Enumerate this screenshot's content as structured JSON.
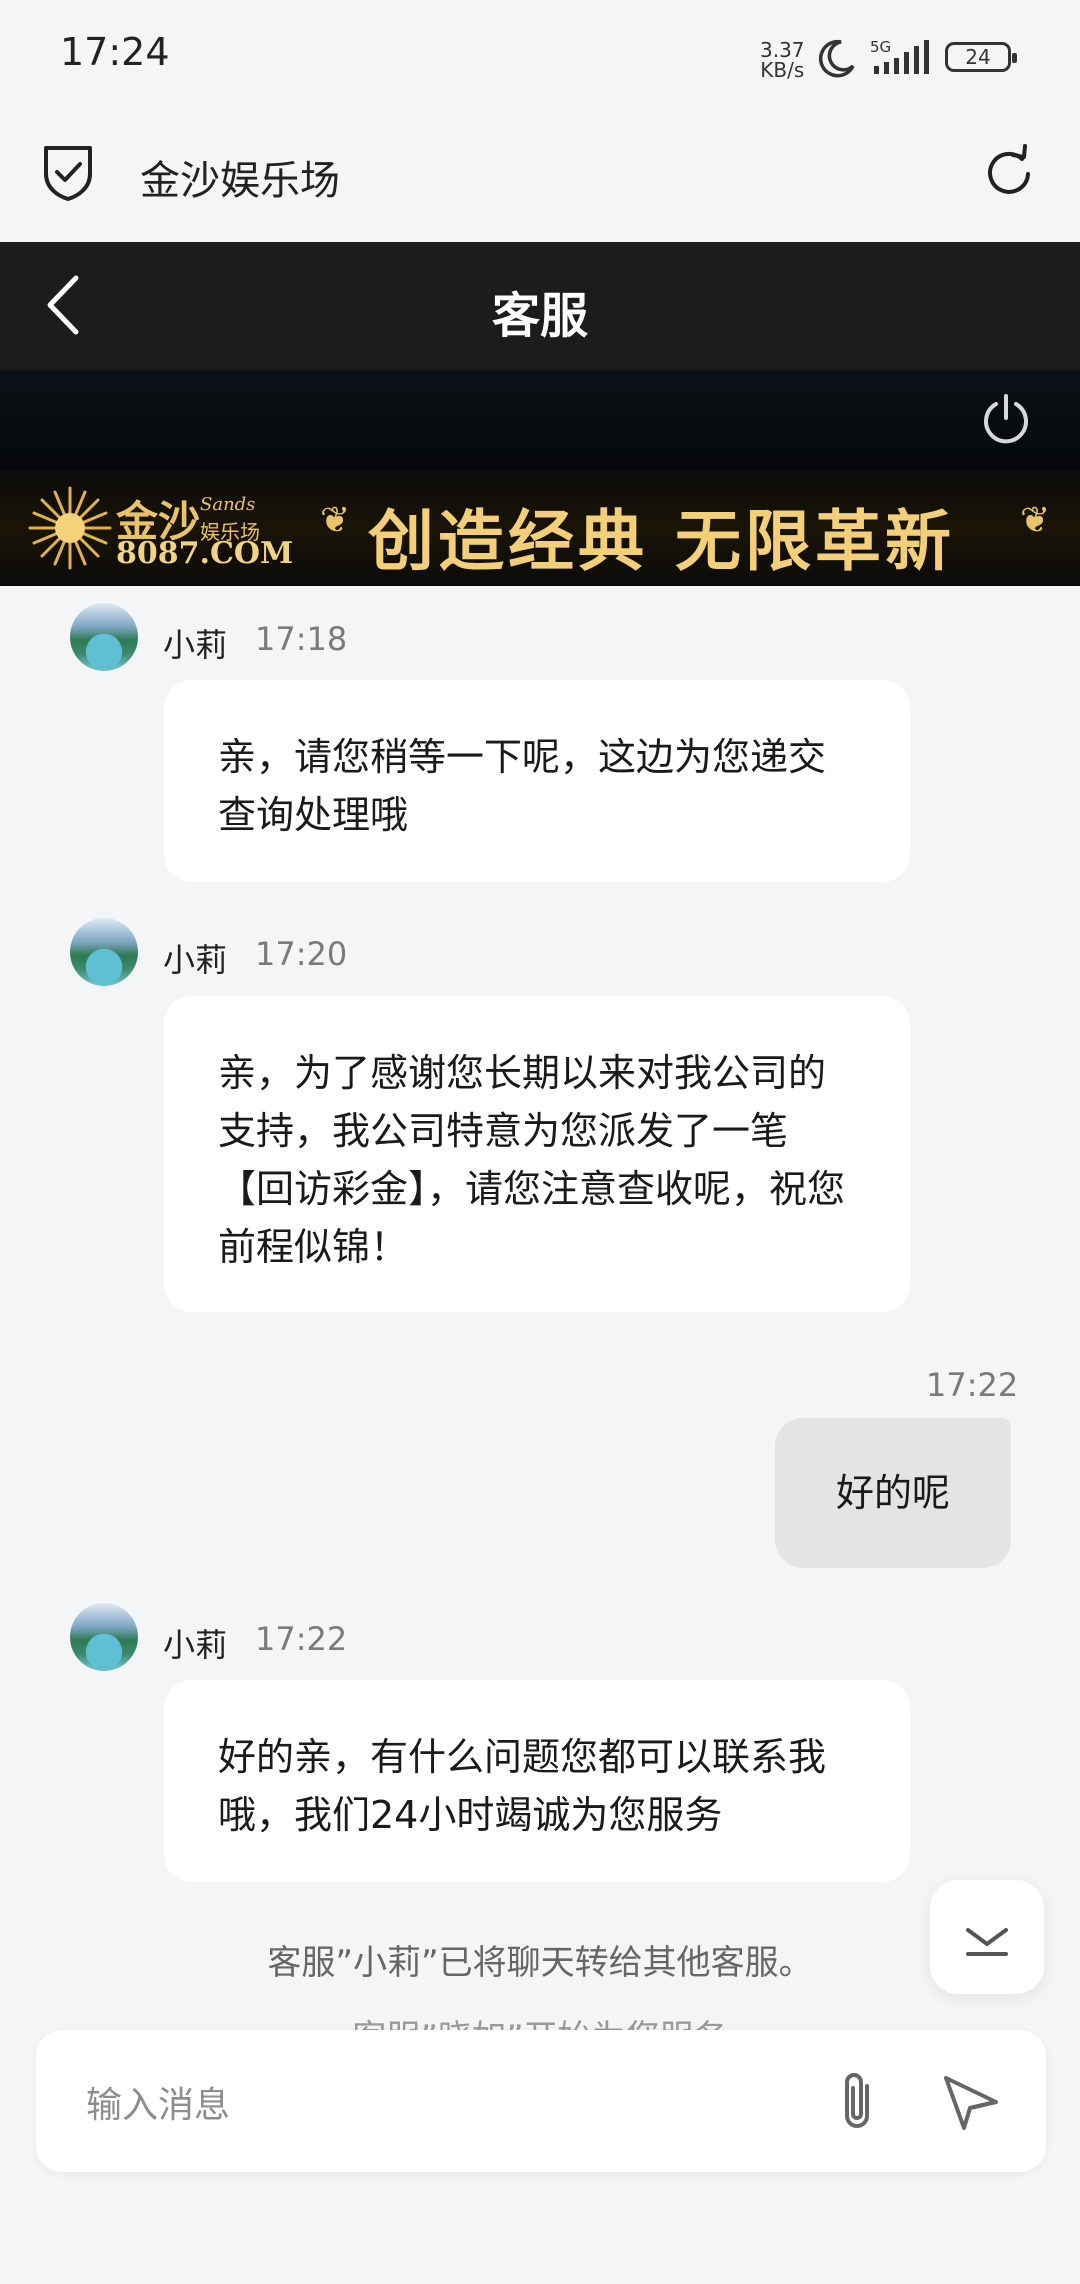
{
  "status_bar": {
    "time": "17:24",
    "net_speed_value": "3.37",
    "net_speed_unit": "KB/s",
    "network": "5G",
    "battery": "24"
  },
  "browser_bar": {
    "title": "金沙娱乐场"
  },
  "chat_header": {
    "title": "客服"
  },
  "banner": {
    "brand_name": "金沙",
    "brand_sands": "Sands",
    "brand_sub": "娱乐场",
    "brand_url": "8087.COM",
    "slogan": "创造经典 无限革新"
  },
  "messages": [
    {
      "sender": "小莉",
      "time": "17:18",
      "text": "亲，请您稍等一下呢，这边为您递交查询处理哦"
    },
    {
      "sender": "小莉",
      "time": "17:20",
      "text": "亲，为了感谢您长期以来对我公司的支持，我公司特意为您派发了一笔【回访彩金】，请您注意查收呢，祝您前程似锦！"
    },
    {
      "sender": "me",
      "time": "17:22",
      "text": "好的呢"
    },
    {
      "sender": "小莉",
      "time": "17:22",
      "text": "好的亲，有什么问题您都可以联系我哦，我们24小时竭诚为您服务"
    }
  ],
  "system_notice": "客服”小莉”已将聊天转给其他客服。",
  "system_notice_2": "客服”晓如”开始为您服务",
  "input": {
    "placeholder": "输入消息"
  }
}
